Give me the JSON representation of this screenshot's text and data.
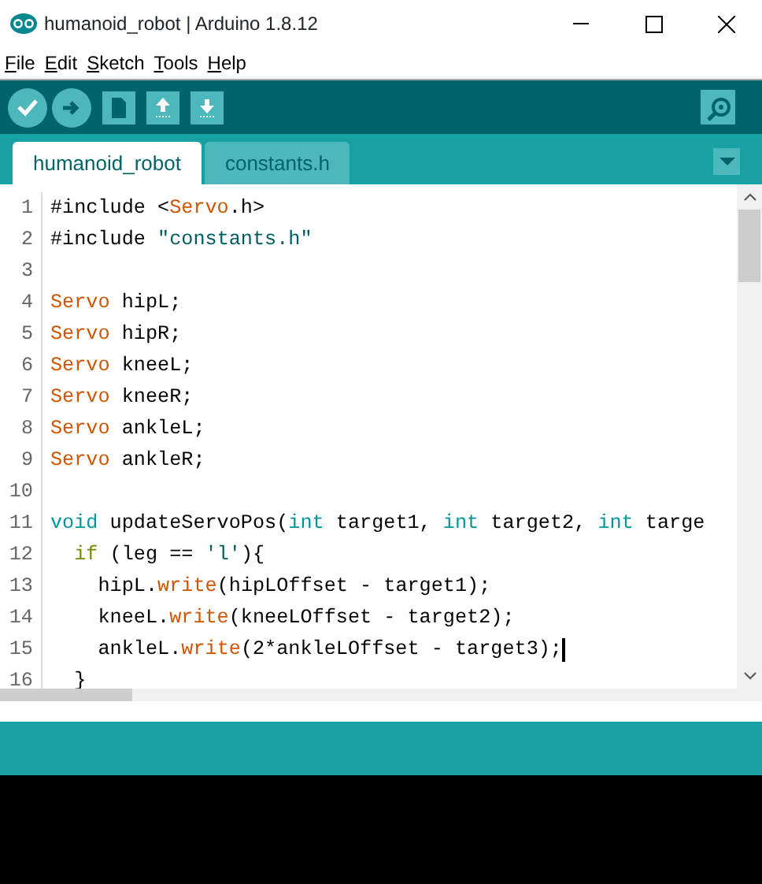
{
  "window": {
    "title": "humanoid_robot | Arduino 1.8.12"
  },
  "menu": [
    {
      "label": "File"
    },
    {
      "label": "Edit"
    },
    {
      "label": "Sketch"
    },
    {
      "label": "Tools"
    },
    {
      "label": "Help"
    }
  ],
  "toolbar": [
    {
      "kind": "verify"
    },
    {
      "kind": "upload"
    },
    {
      "kind": "new"
    },
    {
      "kind": "open"
    },
    {
      "kind": "save"
    }
  ],
  "tabs": [
    {
      "label": "humanoid_robot",
      "selected": true
    },
    {
      "label": "constants.h",
      "selected": false
    }
  ],
  "code": [
    {
      "number": "1",
      "cursor": false,
      "tokens": [
        {
          "text": "#include <",
          "kind": "plain"
        },
        {
          "text": "Servo",
          "kind": "keyword"
        },
        {
          "text": ".h>",
          "kind": "plain"
        }
      ]
    },
    {
      "number": "2",
      "cursor": false,
      "tokens": [
        {
          "text": "#include ",
          "kind": "plain"
        },
        {
          "text": "\"constants.h\"",
          "kind": "string"
        }
      ]
    },
    {
      "number": "3",
      "cursor": false
    },
    {
      "number": "4",
      "cursor": false,
      "tokens": [
        {
          "text": "Servo",
          "kind": "keyword"
        },
        {
          "text": " hipL;",
          "kind": "plain"
        }
      ]
    },
    {
      "number": "5",
      "cursor": false,
      "tokens": [
        {
          "text": "Servo",
          "kind": "keyword"
        },
        {
          "text": " hipR;",
          "kind": "plain"
        }
      ]
    },
    {
      "number": "6",
      "cursor": false,
      "tokens": [
        {
          "text": "Servo",
          "kind": "keyword"
        },
        {
          "text": " kneeL;",
          "kind": "plain"
        }
      ]
    },
    {
      "number": "7",
      "cursor": false,
      "tokens": [
        {
          "text": "Servo",
          "kind": "keyword"
        },
        {
          "text": " kneeR;",
          "kind": "plain"
        }
      ]
    },
    {
      "number": "8",
      "cursor": false,
      "tokens": [
        {
          "text": "Servo",
          "kind": "keyword"
        },
        {
          "text": " ankleL;",
          "kind": "plain"
        }
      ]
    },
    {
      "number": "9",
      "cursor": false,
      "tokens": [
        {
          "text": "Servo",
          "kind": "keyword"
        },
        {
          "text": " ankleR;",
          "kind": "plain"
        }
      ]
    },
    {
      "number": "10",
      "cursor": false
    },
    {
      "number": "11",
      "cursor": false,
      "tokens": [
        {
          "text": "void",
          "kind": "type"
        },
        {
          "text": " updateServoPos(",
          "kind": "plain"
        },
        {
          "text": "int",
          "kind": "type"
        },
        {
          "text": " target1, ",
          "kind": "plain"
        },
        {
          "text": "int",
          "kind": "type"
        },
        {
          "text": " target2, ",
          "kind": "plain"
        },
        {
          "text": "int",
          "kind": "type"
        },
        {
          "text": " targe",
          "kind": "plain"
        }
      ]
    },
    {
      "number": "12",
      "cursor": false,
      "tokens": [
        {
          "text": "  if",
          "kind": "control"
        },
        {
          "text": " (leg == ",
          "kind": "plain"
        },
        {
          "text": "'l'",
          "kind": "string"
        },
        {
          "text": "){",
          "kind": "plain"
        }
      ]
    },
    {
      "number": "13",
      "cursor": false,
      "tokens": [
        {
          "text": "    hipL.",
          "kind": "plain"
        },
        {
          "text": "write",
          "kind": "keyword"
        },
        {
          "text": "(hipLOffset - target1);",
          "kind": "plain"
        }
      ]
    },
    {
      "number": "14",
      "cursor": false,
      "tokens": [
        {
          "text": "    kneeL.",
          "kind": "plain"
        },
        {
          "text": "write",
          "kind": "keyword"
        },
        {
          "text": "(kneeLOffset - target2);",
          "kind": "plain"
        }
      ]
    },
    {
      "number": "15",
      "cursor": true,
      "tokens": [
        {
          "text": "    ankleL.",
          "kind": "plain"
        },
        {
          "text": "write",
          "kind": "keyword"
        },
        {
          "text": "(2*ankleLOffset - target3);",
          "kind": "plain"
        }
      ]
    },
    {
      "number": "16",
      "cursor": false,
      "tokens": [
        {
          "text": "  }",
          "kind": "plain"
        }
      ]
    }
  ]
}
